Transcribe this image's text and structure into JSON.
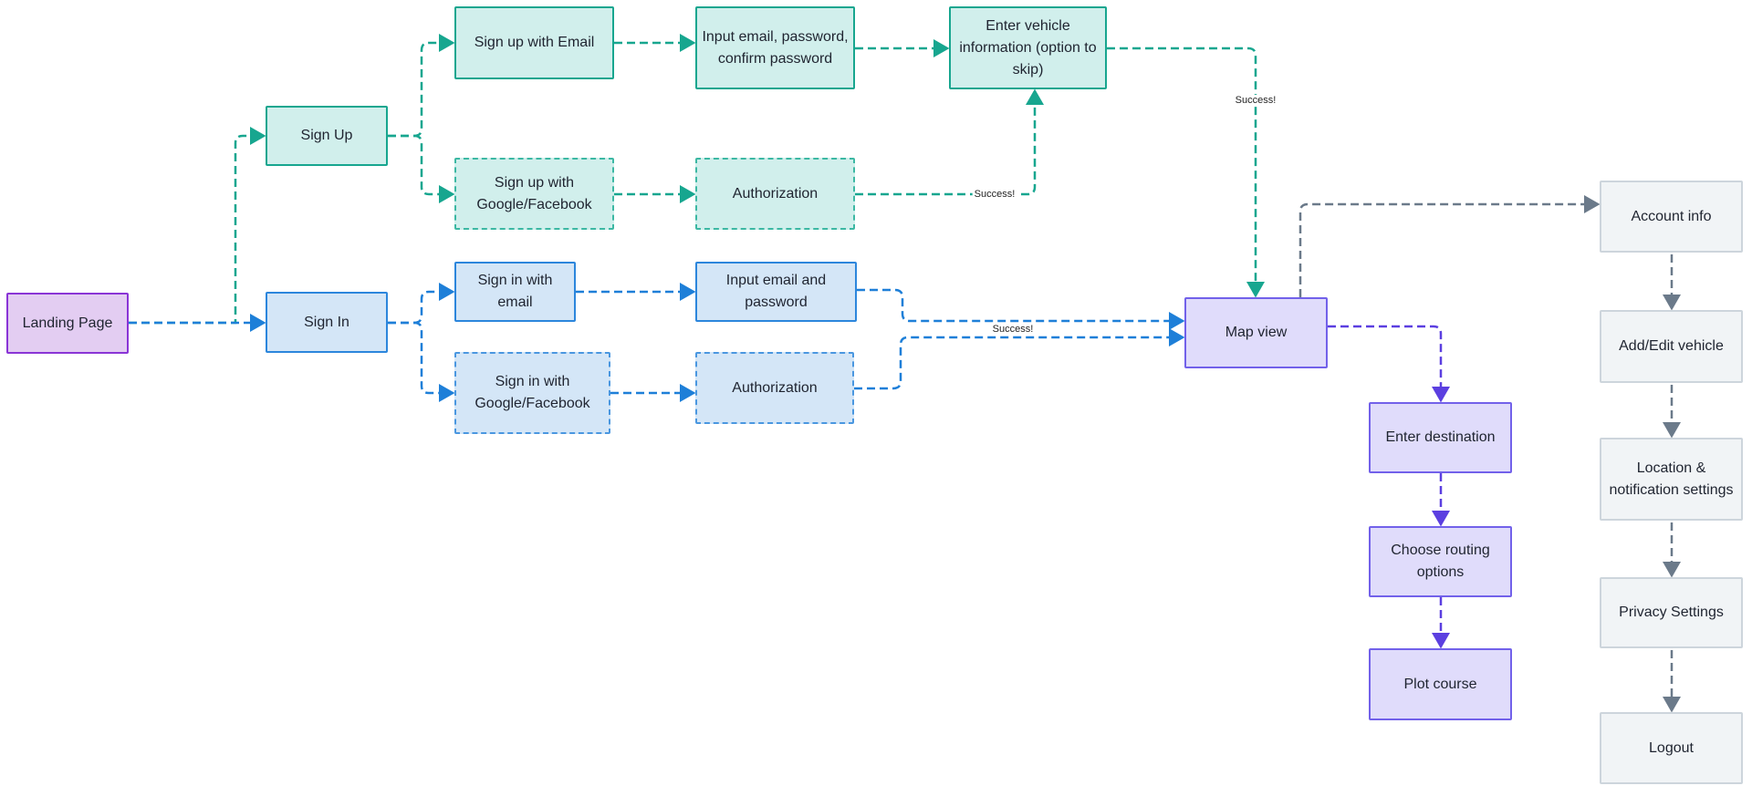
{
  "colors": {
    "signup": "#17a68f",
    "signin": "#1e7fd8",
    "map": "#5b3fe0",
    "settings": "#6b7a8a"
  },
  "nodes": {
    "landing": "Landing Page",
    "sign_up": "Sign Up",
    "sign_in": "Sign In",
    "signup_email": "Sign up with Email",
    "signup_input": "Input email, password, confirm password",
    "vehicle": "Enter vehicle information (option to skip)",
    "signup_social": "Sign up with Google/Facebook",
    "signup_auth": "Authorization",
    "signin_email": "Sign in with email",
    "signin_input": "Input email and password",
    "signin_social": "Sign in with Google/Facebook",
    "signin_auth": "Authorization",
    "map": "Map view",
    "destination": "Enter destination",
    "routing": "Choose routing options",
    "plot": "Plot course",
    "account": "Account info",
    "add_vehicle": "Add/Edit vehicle",
    "location": "Location & notification settings",
    "privacy": "Privacy Settings",
    "logout": "Logout"
  },
  "edge_labels": {
    "signup_social_success": "Success!",
    "vehicle_success": "Success!",
    "signin_success": "Success!"
  }
}
